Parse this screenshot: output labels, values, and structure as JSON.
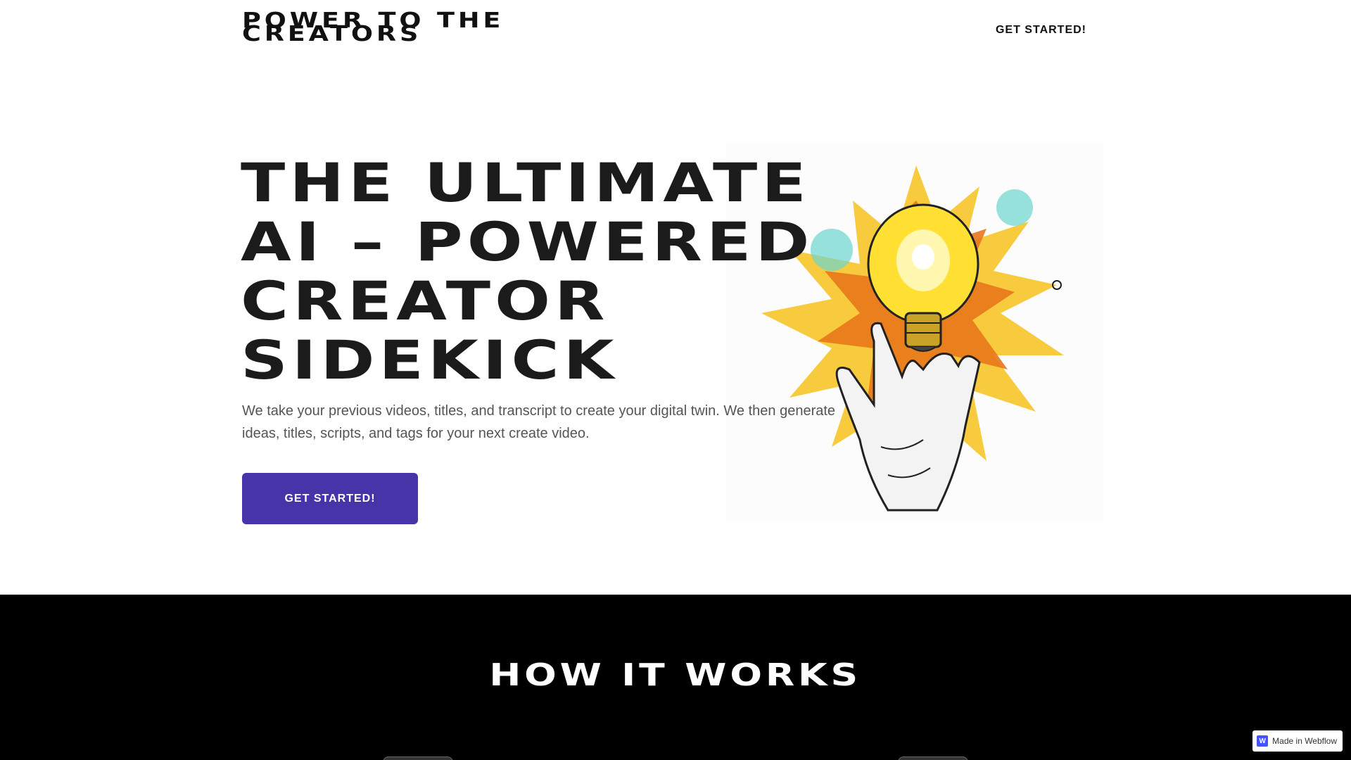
{
  "header": {
    "brand_line1": "POWER TO THE",
    "brand_line2": "CREATORS",
    "cta_label": "GET STARTED!"
  },
  "hero": {
    "title_line1": "THE ULTIMATE",
    "title_line2": "AI – POWERED",
    "title_line3": "CREATOR",
    "title_line4": "SIDEKICK",
    "description": "We take your previous videos, titles, and transcript to create your digital twin. We then generate ideas, titles, scripts, and tags for your next create video.",
    "button_label": "GET STARTED!",
    "image_icon": "lightbulb-hand-illustration"
  },
  "how_it_works": {
    "title": "HOW IT WORKS"
  },
  "badge": {
    "label": "Made in Webflow",
    "icon_letter": "W"
  },
  "colors": {
    "accent": "#4634a8",
    "dark_section": "#000000",
    "text_dark": "#1b1b1b",
    "text_muted": "#555555"
  }
}
